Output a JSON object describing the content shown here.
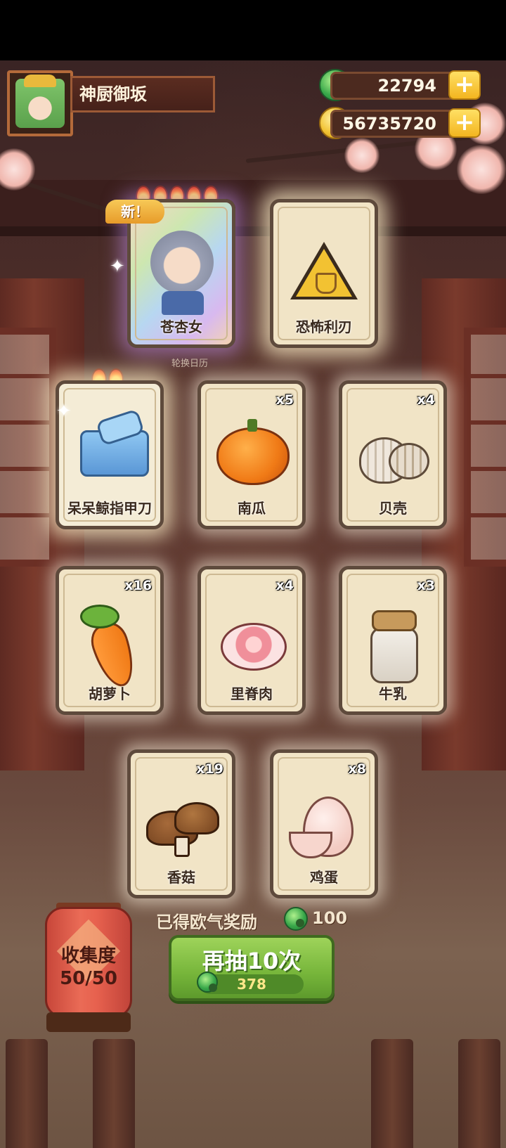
{
  "player": {
    "name": "神厨御坂"
  },
  "currency": {
    "jade": "22794",
    "coins": "56735720",
    "add_symbol": "+"
  },
  "gacha": {
    "new_badge": "新！",
    "sub_caption": "轮换日历",
    "cards": [
      {
        "label": "苍杏女",
        "count": "",
        "flames": 5
      },
      {
        "label": "恐怖利刃",
        "count": ""
      },
      {
        "label": "呆呆鲸指甲刀",
        "count": "",
        "flames": 2
      },
      {
        "label": "南瓜",
        "count": "x5"
      },
      {
        "label": "贝壳",
        "count": "x4"
      },
      {
        "label": "胡萝卜",
        "count": "x16"
      },
      {
        "label": "里脊肉",
        "count": "x4"
      },
      {
        "label": "牛乳",
        "count": "x3"
      },
      {
        "label": "香菇",
        "count": "x19"
      },
      {
        "label": "鸡蛋",
        "count": "x8"
      }
    ]
  },
  "reward": {
    "label": "已得欧气奖励",
    "value": "100"
  },
  "draw": {
    "label": "再抽10次",
    "cost": "378"
  },
  "collection": {
    "label": "收集度",
    "value": "50/50"
  },
  "colors": {
    "jade": "#39a84a",
    "coin": "#f1c232",
    "button_green": "#76b53a",
    "lantern_red": "#e7614e",
    "card_bg": "#f1e4c6"
  }
}
